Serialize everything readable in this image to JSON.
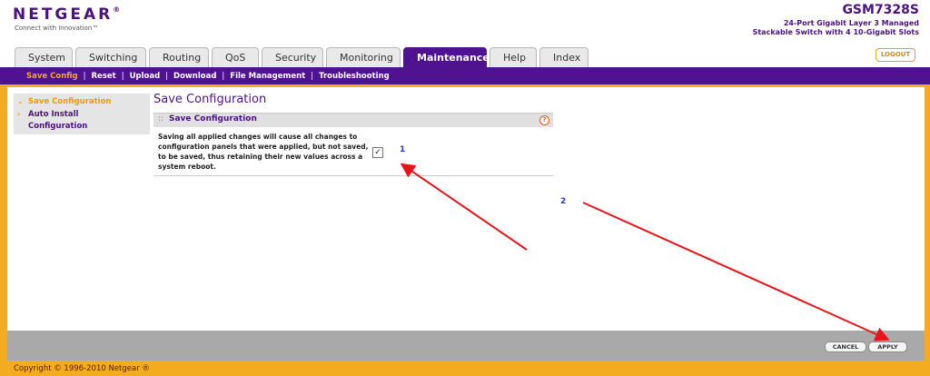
{
  "header": {
    "brand": "NETGEAR",
    "brand_mark": "®",
    "tagline": "Connect with Innovation™",
    "model": "GSM7328S",
    "model_desc_line1": "24-Port Gigabit Layer 3 Managed",
    "model_desc_line2": "Stackable Switch with 4 10-Gigabit Slots",
    "logout_label": "LOGOUT"
  },
  "tabs": [
    {
      "label": "System"
    },
    {
      "label": "Switching"
    },
    {
      "label": "Routing"
    },
    {
      "label": "QoS"
    },
    {
      "label": "Security"
    },
    {
      "label": "Monitoring"
    },
    {
      "label": "Maintenance",
      "active": true
    },
    {
      "label": "Help"
    },
    {
      "label": "Index"
    }
  ],
  "subnav": [
    {
      "label": "Save Config",
      "active": true
    },
    {
      "label": "Reset"
    },
    {
      "label": "Upload"
    },
    {
      "label": "Download"
    },
    {
      "label": "File Management"
    },
    {
      "label": "Troubleshooting"
    }
  ],
  "sidebar": {
    "items": [
      {
        "label": "Save Configuration",
        "active": true
      },
      {
        "label_line1": "Auto Install",
        "label_line2": "Configuration"
      }
    ]
  },
  "page": {
    "title": "Save Configuration",
    "panel_title": "Save Configuration",
    "help_glyph": "?",
    "description_line1": "Saving all applied changes will cause all changes to",
    "description_line2": "configuration panels that were applied, but not saved,",
    "description_line3": "to be saved, thus retaining their new values across a",
    "description_line4": "system reboot.",
    "checkbox_checked": true
  },
  "annotations": {
    "marker1": "1",
    "marker2": "2",
    "arrow_color": "#e8141a"
  },
  "footer": {
    "cancel_label": "CANCEL",
    "apply_label": "APPLY",
    "copyright": "Copyright © 1996-2010 Netgear ®"
  },
  "colors": {
    "brand_purple": "#4f138f",
    "accent_orange": "#f3ab1f"
  }
}
